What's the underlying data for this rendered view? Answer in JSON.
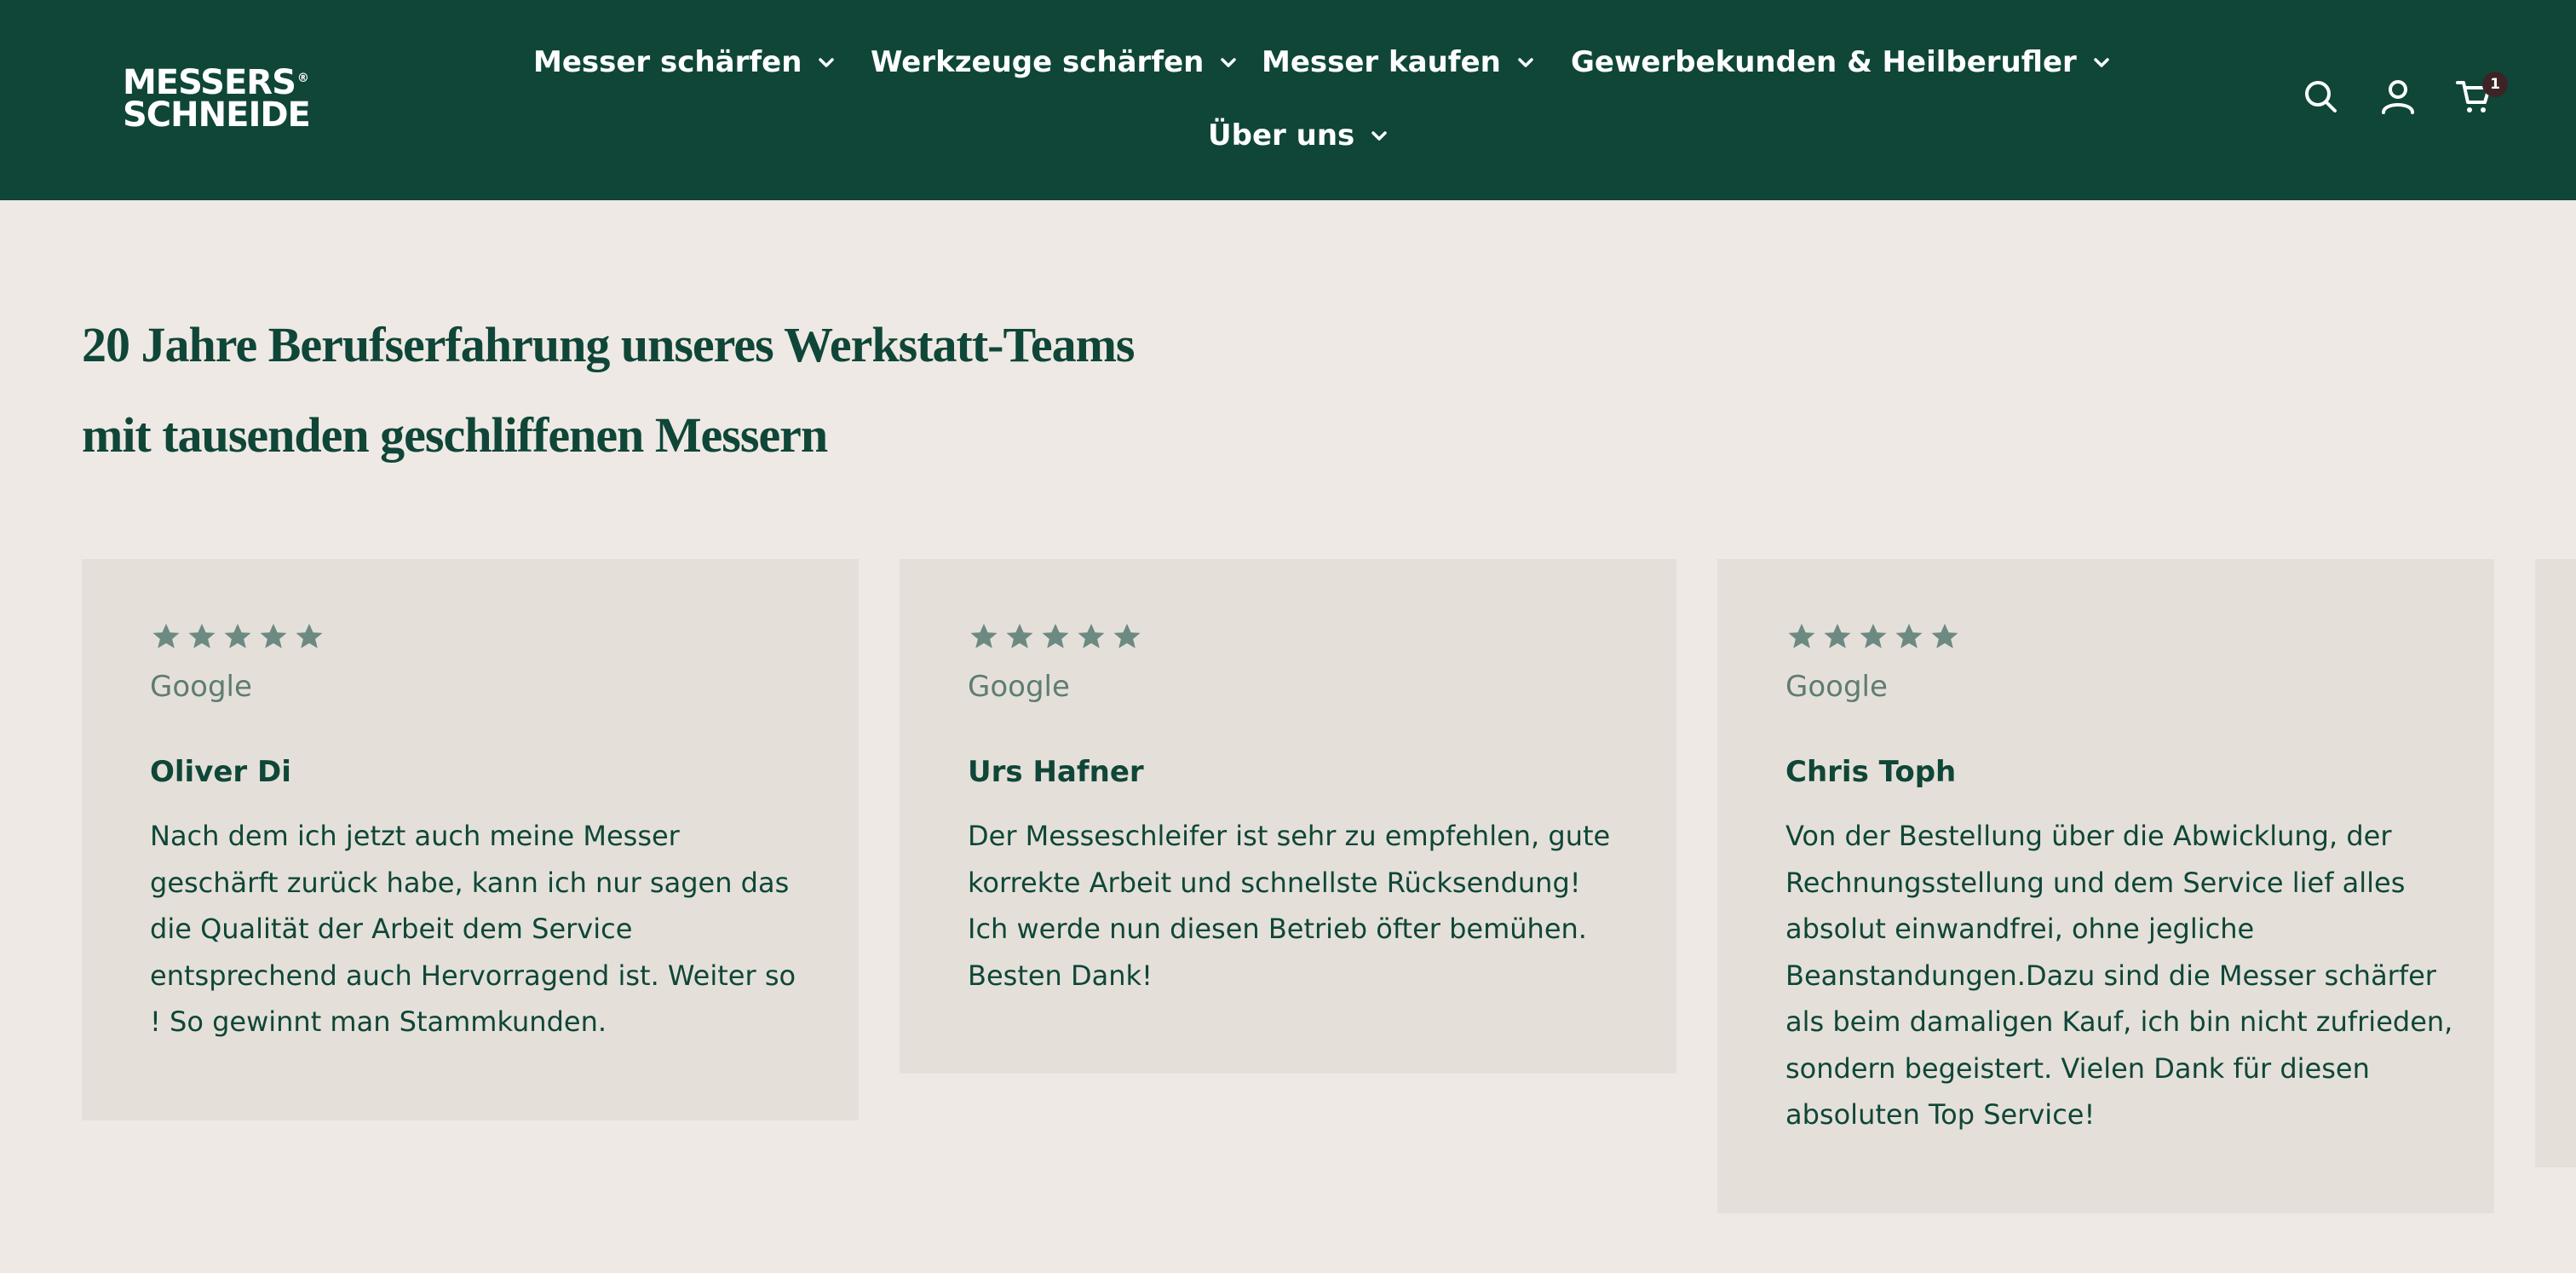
{
  "header": {
    "logo": {
      "line1": "MESSERS",
      "line2": "SCHNEIDE",
      "reg": "®"
    },
    "nav": [
      {
        "label": "Messer schärfen"
      },
      {
        "label": "Werkzeuge schärfen"
      },
      {
        "label": "Messer kaufen"
      },
      {
        "label": "Gewerbekunden & Heilberufler"
      },
      {
        "label": "Über uns"
      }
    ],
    "icons": [
      "search-icon",
      "account-icon",
      "cart-icon"
    ],
    "cart_count": "1"
  },
  "section": {
    "heading_lines": [
      "20 Jahre Berufserfahrung unseres Werkstatt-Teams",
      "mit tausenden geschliffenen Messern"
    ]
  },
  "reviews": [
    {
      "rating": 5,
      "source": "Google",
      "name": "Oliver Di",
      "lines": [
        "Nach dem ich jetzt auch meine Messer",
        "geschärft zurück habe, kann ich nur sagen das",
        "die Qualität der Arbeit dem Service",
        "entsprechend auch Hervorragend ist. Weiter so",
        "! So gewinnt man Stammkunden."
      ]
    },
    {
      "rating": 5,
      "source": "Google",
      "name": "Urs Hafner",
      "lines": [
        "Der Messeschleifer ist sehr zu empfehlen, gute",
        "korrekte Arbeit und schnellste Rücksendung!",
        "Ich werde nun diesen Betrieb öfter bemühen.",
        "Besten Dank!"
      ]
    },
    {
      "rating": 5,
      "source": "Google",
      "name": "Chris Toph",
      "lines": [
        "Von der Bestellung über die Abwicklung, der",
        "Rechnungsstellung und dem Service lief alles",
        "absolut einwandfrei, ohne jegliche",
        "Beanstandungen.Dazu sind die Messer schärfer",
        "als beim damaligen Kauf, ich bin nicht zufrieden,",
        "sondern begeistert. Vielen Dank für diesen",
        "absoluten Top Service!"
      ]
    }
  ],
  "colors": {
    "header_bg": "#0f4638",
    "page_bg": "#eee9e4",
    "card_bg": "#e4e0d9",
    "star": "#6d8a82",
    "badge_bg": "#3d2326"
  }
}
